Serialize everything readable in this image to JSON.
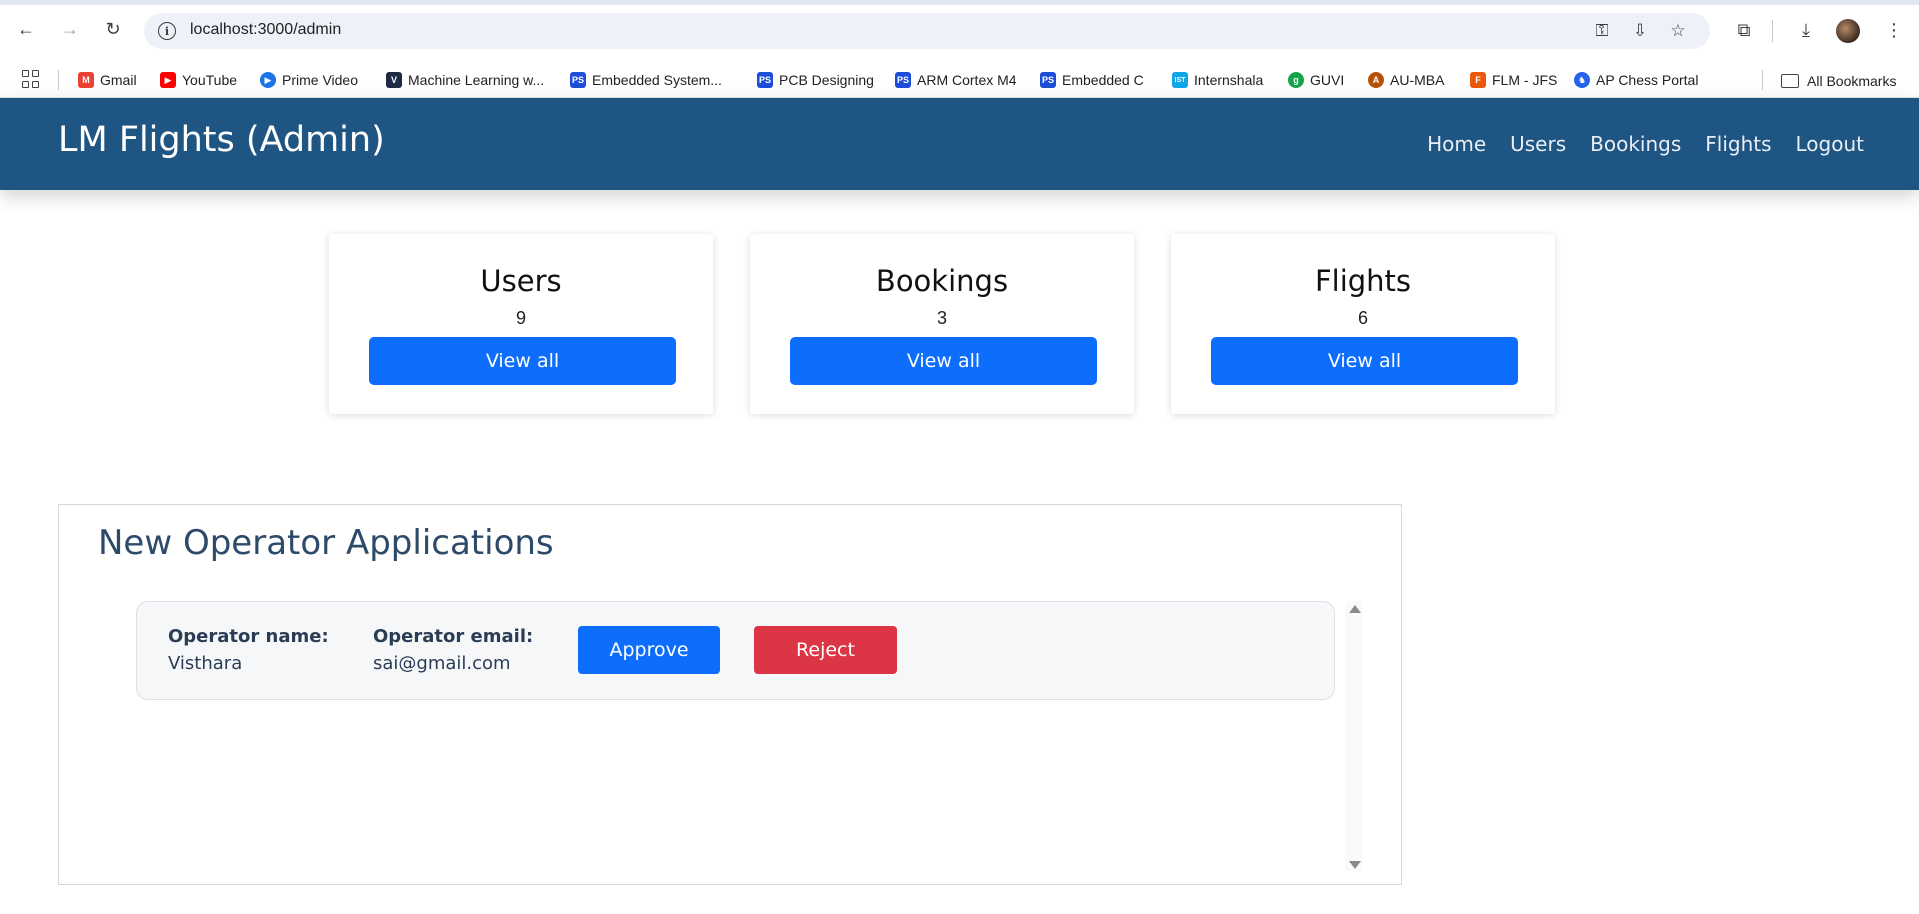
{
  "browser": {
    "url": "localhost:3000/admin",
    "bookmarks": [
      {
        "label": "Gmail",
        "icon": "gmail-icon",
        "color": "#ea4335",
        "glyph": "M"
      },
      {
        "label": "YouTube",
        "icon": "youtube-icon",
        "color": "#ff0000",
        "glyph": "▶"
      },
      {
        "label": "Prime Video",
        "icon": "prime-video-icon",
        "color": "#1a73e8",
        "glyph": "▶"
      },
      {
        "label": "Machine Learning w...",
        "icon": "machine-learning-icon",
        "color": "#1f2a44",
        "glyph": "V"
      },
      {
        "label": "Embedded System...",
        "icon": "embedded-systems-icon",
        "color": "#1d4ed8",
        "glyph": "PS"
      },
      {
        "label": "PCB Designing",
        "icon": "pcb-designing-icon",
        "color": "#1d4ed8",
        "glyph": "PS"
      },
      {
        "label": "ARM Cortex M4",
        "icon": "arm-cortex-icon",
        "color": "#1d4ed8",
        "glyph": "PS"
      },
      {
        "label": "Embedded C",
        "icon": "embedded-c-icon",
        "color": "#1d4ed8",
        "glyph": "PS"
      },
      {
        "label": "Internshala",
        "icon": "internshala-icon",
        "color": "#0ea5e9",
        "glyph": "IST"
      },
      {
        "label": "GUVI",
        "icon": "guvi-icon",
        "color": "#16a34a",
        "glyph": "g"
      },
      {
        "label": "AU-MBA",
        "icon": "au-mba-icon",
        "color": "#b45309",
        "glyph": "A"
      },
      {
        "label": "FLM - JFS",
        "icon": "flm-jfs-icon",
        "color": "#ea580c",
        "glyph": "F"
      },
      {
        "label": "AP Chess Portal",
        "icon": "chess-portal-icon",
        "color": "#2563eb",
        "glyph": "♞"
      }
    ],
    "all_bookmarks_label": "All Bookmarks"
  },
  "navbar": {
    "brand": "LM Flights (Admin)",
    "links": [
      "Home",
      "Users",
      "Bookings",
      "Flights",
      "Logout"
    ]
  },
  "stats": [
    {
      "title": "Users",
      "count": "9",
      "button": "View all"
    },
    {
      "title": "Bookings",
      "count": "3",
      "button": "View all"
    },
    {
      "title": "Flights",
      "count": "6",
      "button": "View all"
    }
  ],
  "applications": {
    "title": "New Operator Applications",
    "items": [
      {
        "name_label": "Operator name:",
        "name": "Visthara",
        "email_label": "Operator email:",
        "email": "sai@gmail.com",
        "approve_label": "Approve",
        "reject_label": "Reject"
      }
    ]
  },
  "colors": {
    "navbar": "#1e5583",
    "primary": "#0d6efd",
    "danger": "#dc3545",
    "heading": "#2d4a69"
  }
}
